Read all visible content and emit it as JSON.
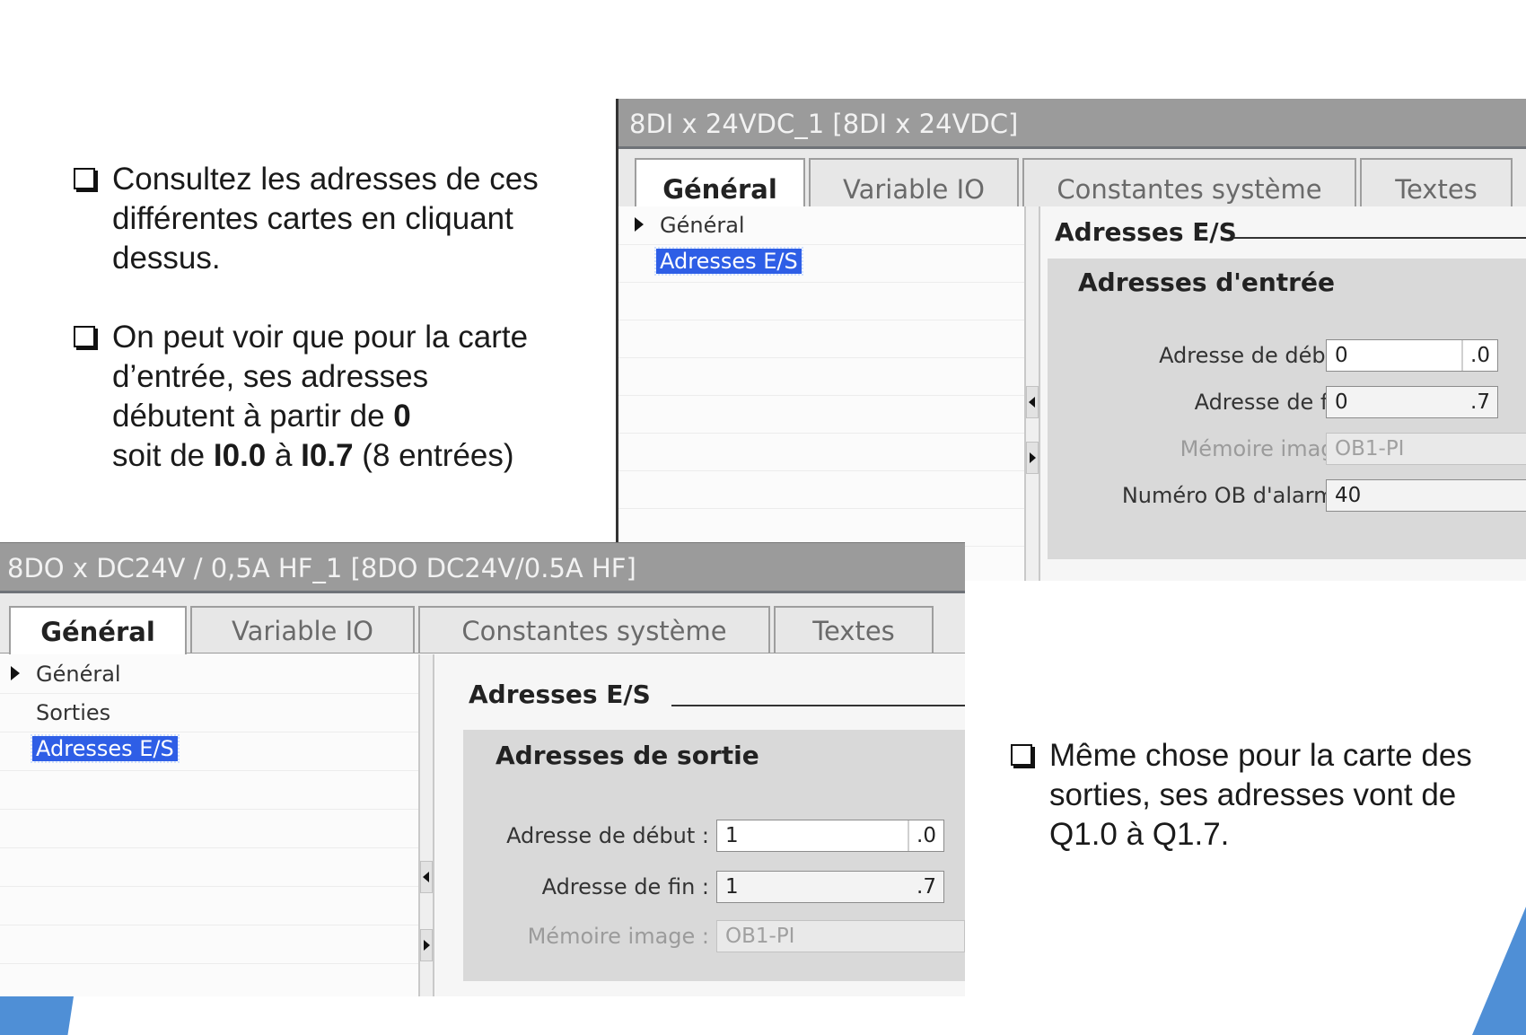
{
  "slide": {
    "bullet1": "Consultez les adresses de ces différentes cartes en cliquant dessus.",
    "bullet2_line1": "On peut voir que pour la carte",
    "bullet2_line2": "d’entrée, ses adresses",
    "bullet2_line3_prefix": "débutent à partir de ",
    "bullet2_line3_bold": "0",
    "bullet2_line4_prefix": "soit de ",
    "bullet2_line4_b1": "I0.0",
    "bullet2_line4_mid": " à ",
    "bullet2_line4_b2": "I0.7",
    "bullet2_line4_suffix": " (8 entrées)",
    "bullet3": "Même chose pour la carte des sorties, ses adresses vont de Q1.0 à Q1.7."
  },
  "input_module": {
    "title": "8DI x 24VDC_1 [8DI x 24VDC]",
    "tabs": [
      "Général",
      "Variable IO",
      "Constantes système",
      "Textes"
    ],
    "active_tab": "Général",
    "tree": [
      "Général",
      "Adresses E/S"
    ],
    "selected_tree_item": "Adresses E/S",
    "section_title": "Adresses E/S",
    "group_title": "Adresses d'entrée",
    "fields": {
      "start_label": "Adresse de début :",
      "start_value": "0",
      "start_suffix": ".0",
      "end_label": "Adresse de fin :",
      "end_value": "0",
      "end_suffix": ".7",
      "image_label": "Mémoire image :",
      "image_value": "OB1-PI",
      "ob_label": "Numéro OB d'alarme :",
      "ob_value": "40"
    }
  },
  "output_module": {
    "title": "8DO x DC24V / 0,5A HF_1 [8DO DC24V/0.5A HF]",
    "tabs": [
      "Général",
      "Variable IO",
      "Constantes système",
      "Textes"
    ],
    "active_tab": "Général",
    "tree": [
      "Général",
      "Sorties",
      "Adresses E/S"
    ],
    "selected_tree_item": "Adresses E/S",
    "section_title": "Adresses E/S",
    "group_title": "Adresses de sortie",
    "fields": {
      "start_label": "Adresse de début :",
      "start_value": "1",
      "start_suffix": ".0",
      "end_label": "Adresse de fin :",
      "end_value": "1",
      "end_suffix": ".7",
      "image_label": "Mémoire image :",
      "image_value": "OB1-PI"
    }
  },
  "colors": {
    "selection": "#2e5ee6",
    "titlebar": "#9b9b9b",
    "accent_corner": "#4f8fd6"
  }
}
